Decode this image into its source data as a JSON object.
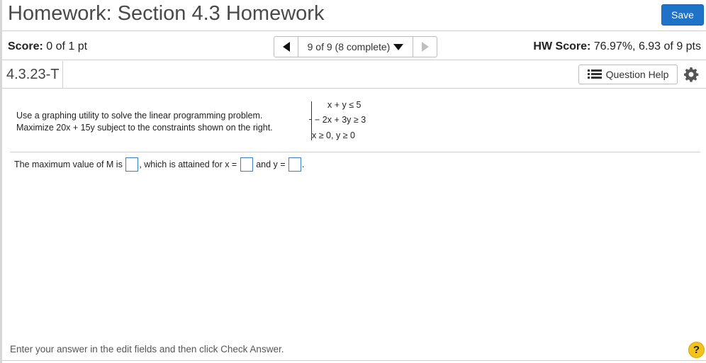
{
  "header": {
    "title": "Homework: Section 4.3 Homework",
    "save_label": "Save"
  },
  "scorebar": {
    "score_label": "Score:",
    "score_value": "0 of 1 pt",
    "nav_status": "9 of 9 (8 complete)",
    "hw_score_label": "HW Score:",
    "hw_score_value": "76.97%, 6.93 of 9 pts"
  },
  "question": {
    "id": "4.3.23-T",
    "help_label": "Question Help",
    "prompt_line1": "Use a graphing utility to solve the linear programming problem.",
    "prompt_line2": "Maximize 20x + 15y subject to the constraints shown on the right.",
    "constraints": [
      "x +   y ≤ 5",
      "− 2x + 3y ≥ 3",
      "x ≥ 0, y ≥ 0"
    ],
    "answer_part1": "The maximum value of M is",
    "answer_part2": ", which is attained for x =",
    "answer_part3": "and y =",
    "answer_part4": "."
  },
  "footer": {
    "instruction": "Enter your answer in the edit fields and then click Check Answer.",
    "help_glyph": "?"
  },
  "colors": {
    "save_button": "#1e73c9",
    "answer_box_border": "#3a7fc4",
    "help_circle": "#f3c21d"
  },
  "icons": [
    "chevron-left-icon",
    "chevron-down-icon",
    "chevron-right-icon",
    "list-icon",
    "gear-icon",
    "question-icon"
  ]
}
